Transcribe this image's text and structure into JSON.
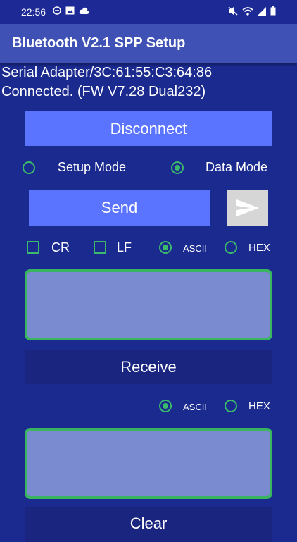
{
  "status_bar": {
    "time": "22:56"
  },
  "app_bar": {
    "title": "Bluetooth V2.1 SPP Setup"
  },
  "device": {
    "line1": "Serial Adapter/3C:61:55:C3:64:86",
    "line2": "Connected. (FW V7.28 Dual232)"
  },
  "buttons": {
    "disconnect": "Disconnect",
    "send": "Send",
    "receive": "Receive",
    "clear": "Clear"
  },
  "modes": {
    "setup_label": "Setup Mode",
    "data_label": "Data Mode",
    "selected": "Data Mode"
  },
  "send_options": {
    "cr_label": "CR",
    "lf_label": "LF",
    "ascii_label": "ASCII",
    "hex_label": "HEX",
    "cr_checked": false,
    "lf_checked": false,
    "selected_format": "ASCII"
  },
  "receive_options": {
    "ascii_label": "ASCII",
    "hex_label": "HEX",
    "selected_format": "ASCII"
  },
  "colors": {
    "background": "#1a2a8f",
    "app_bar": "#3f51b5",
    "button": "#5b74ff",
    "accent_green": "#3cba6b",
    "textbox": "#7b8bd0"
  }
}
